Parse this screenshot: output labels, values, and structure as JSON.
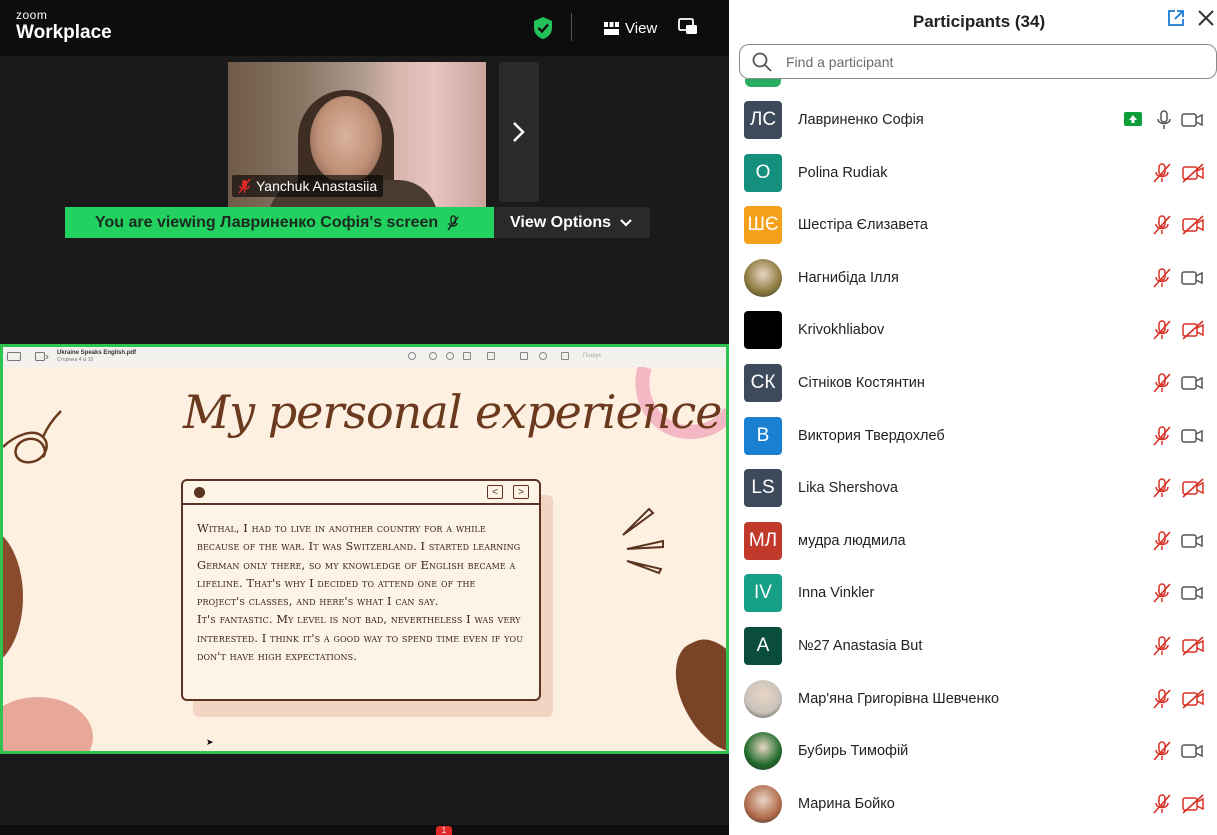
{
  "app": {
    "logo_top": "zoom",
    "logo_bottom": "Workplace",
    "view_label": "View"
  },
  "video": {
    "participant_name": "Yanchuk Anastasiia"
  },
  "banner": {
    "viewing_text": "You are viewing  Лавриненко Софія's screen",
    "view_options_label": "View Options"
  },
  "shared_doc": {
    "file_name": "Ukraine Speaks English.pdf",
    "page_info": "Сторінка 4 із 10",
    "search_placeholder": "Пошук",
    "slide_title": "My personal experience",
    "card_text": "Withal, I had to live in another country for a while because of the war. It was Switzerland. I started learning German only there, so my knowledge of English became a lifeline. That's why I decided to attend one of the project's classes, and here's what I can say.\nIt's fantastic. My level is not bad, nevertheless I was very interested. I think it's a good way to spend time even if you don't have high expectations."
  },
  "bottom_bar": {
    "chat_badge": "1"
  },
  "participants_panel": {
    "title": "Participants (34)",
    "search_placeholder": "Find a participant",
    "participants": [
      {
        "name": "Лавриненко Софія",
        "initials": "ЛС",
        "avatar_color": "#3d4a5c",
        "sharing": true,
        "mic_muted": false,
        "video_off": false
      },
      {
        "name": "Polina Rudiak",
        "initials": "O",
        "avatar_color": "#16907e",
        "sharing": false,
        "mic_muted": true,
        "video_off": true
      },
      {
        "name": "Шестіра Єлизавета",
        "initials": "ШЄ",
        "avatar_color": "#f5a01a",
        "sharing": false,
        "mic_muted": true,
        "video_off": true
      },
      {
        "name": "Нагнибіда Ілля",
        "initials": "",
        "avatar_color": "#8b7a3e",
        "photo": true,
        "sharing": false,
        "mic_muted": true,
        "video_off": false
      },
      {
        "name": "Krivokhliabov",
        "initials": "",
        "avatar_color": "#000000",
        "sharing": false,
        "mic_muted": true,
        "video_off": true
      },
      {
        "name": "Сітніков Костянтин",
        "initials": "СК",
        "avatar_color": "#3d4a5c",
        "sharing": false,
        "mic_muted": true,
        "video_off": false
      },
      {
        "name": "Виктория Твердохлеб",
        "initials": "В",
        "avatar_color": "#1a80d2",
        "sharing": false,
        "mic_muted": true,
        "video_off": false
      },
      {
        "name": "Lika Shershova",
        "initials": "LS",
        "avatar_color": "#3d4a5c",
        "sharing": false,
        "mic_muted": true,
        "video_off": true
      },
      {
        "name": "мудра людмила",
        "initials": "МЛ",
        "avatar_color": "#c0392b",
        "sharing": false,
        "mic_muted": true,
        "video_off": false
      },
      {
        "name": "Inna Vinkler",
        "initials": "IV",
        "avatar_color": "#16a085",
        "sharing": false,
        "mic_muted": true,
        "video_off": false
      },
      {
        "name": "№27 Anastasia But",
        "initials": "A",
        "avatar_color": "#0b4d3c",
        "sharing": false,
        "mic_muted": true,
        "video_off": true
      },
      {
        "name": "Мар'яна Григорівна Шевченко",
        "initials": "",
        "avatar_color": "#c9c2bb",
        "photo": true,
        "sharing": false,
        "mic_muted": true,
        "video_off": true
      },
      {
        "name": "Бубирь Тимофій",
        "initials": "",
        "avatar_color": "#1f6b2a",
        "photo": true,
        "sharing": false,
        "mic_muted": true,
        "video_off": false
      },
      {
        "name": "Марина Бойко",
        "initials": "",
        "avatar_color": "#b06a4a",
        "photo": true,
        "sharing": false,
        "mic_muted": true,
        "video_off": true
      }
    ]
  },
  "colors": {
    "accent_green": "#23d160",
    "share_border": "#2ec24f",
    "muted_red": "#e02828",
    "slide_brown": "#6b3a1e"
  }
}
